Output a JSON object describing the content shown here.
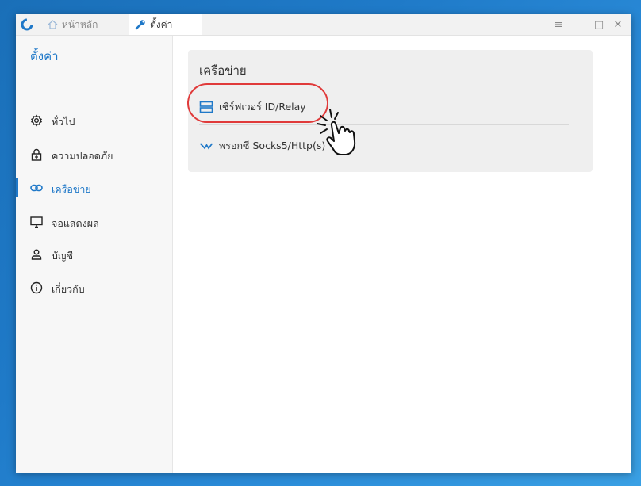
{
  "titlebar": {
    "tabs": [
      {
        "label": "หน้าหลัก",
        "icon": "home-icon"
      },
      {
        "label": "ตั้งค่า",
        "icon": "wrench-icon"
      }
    ],
    "window_controls": [
      "menu-icon",
      "minimize-icon",
      "maximize-icon",
      "close-icon"
    ]
  },
  "sidebar": {
    "title": "ตั้งค่า",
    "items": [
      {
        "label": "ทั่วไป",
        "icon": "gear-icon"
      },
      {
        "label": "ความปลอดภัย",
        "icon": "lock-icon"
      },
      {
        "label": "เครือข่าย",
        "icon": "link-icon",
        "active": true
      },
      {
        "label": "จอแสดงผล",
        "icon": "monitor-icon"
      },
      {
        "label": "บัญชี",
        "icon": "user-icon"
      },
      {
        "label": "เกี่ยวกับ",
        "icon": "info-icon"
      }
    ]
  },
  "main": {
    "section_title": "เครือข่าย",
    "rows": [
      {
        "label": "เซิร์ฟเวอร์ ID/Relay",
        "icon": "server-icon"
      },
      {
        "label": "พรอกซี Socks5/Http(s)",
        "icon": "proxy-icon"
      }
    ]
  },
  "colors": {
    "accent": "#1f78c8",
    "highlight": "#e03a3a",
    "background": "#1f7ac8"
  }
}
